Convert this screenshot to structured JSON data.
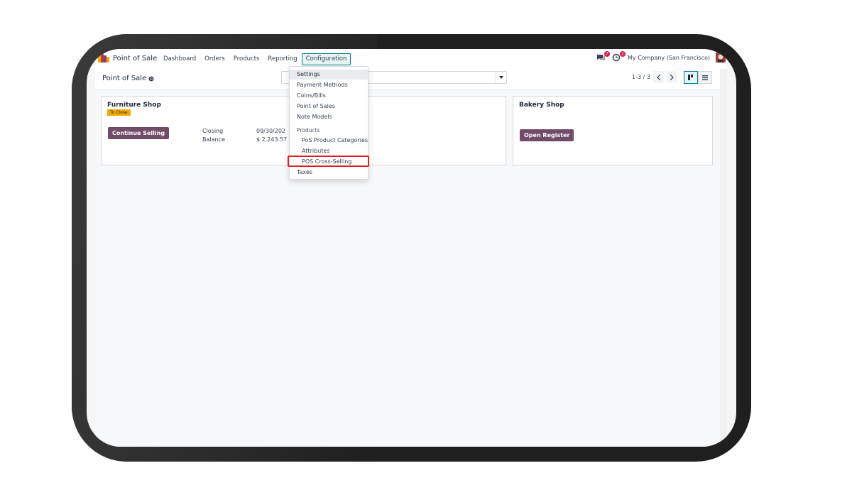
{
  "navbar": {
    "app_name": "Point of Sale",
    "menu": [
      "Dashboard",
      "Orders",
      "Products",
      "Reporting",
      "Configuration"
    ],
    "messages_count": "7",
    "activities_count": "1",
    "company": "My Company (San Francisco)"
  },
  "control_panel": {
    "breadcrumb": "Point of Sale",
    "search_placeholder": "",
    "pager": "1-3 / 3"
  },
  "cards": [
    {
      "title": "Furniture Shop",
      "badge": "To Close",
      "button": "Continue Selling",
      "meta": [
        {
          "label": "Closing",
          "value": "09/30/202"
        },
        {
          "label": "Balance",
          "value": "$ 2,243.57"
        }
      ]
    },
    {
      "title": "Bakery Shop",
      "button": "Open Register"
    }
  ],
  "config_menu": {
    "items": [
      {
        "label": "Settings",
        "type": "item",
        "state": "hover"
      },
      {
        "label": "Payment Methods",
        "type": "item"
      },
      {
        "label": "Coins/Bills",
        "type": "item"
      },
      {
        "label": "Point of Sales",
        "type": "item"
      },
      {
        "label": "Note Models",
        "type": "item"
      },
      {
        "label": "Products",
        "type": "header"
      },
      {
        "label": "PoS Product Categories",
        "type": "sub"
      },
      {
        "label": "Attributes",
        "type": "sub"
      },
      {
        "label": "POS Cross-Selling",
        "type": "sub",
        "highlighted": true
      },
      {
        "label": "Taxes",
        "type": "item"
      }
    ]
  },
  "colors": {
    "primary": "#714b67",
    "accent": "#017e84",
    "badge": "#f4a900",
    "highlight": "#e11d2a"
  },
  "icons": [
    "pos-logo-icon",
    "gear-icon",
    "chat-icon",
    "clock-icon",
    "chevron-left-icon",
    "chevron-right-icon",
    "kanban-icon",
    "list-icon",
    "caret-down-icon"
  ]
}
